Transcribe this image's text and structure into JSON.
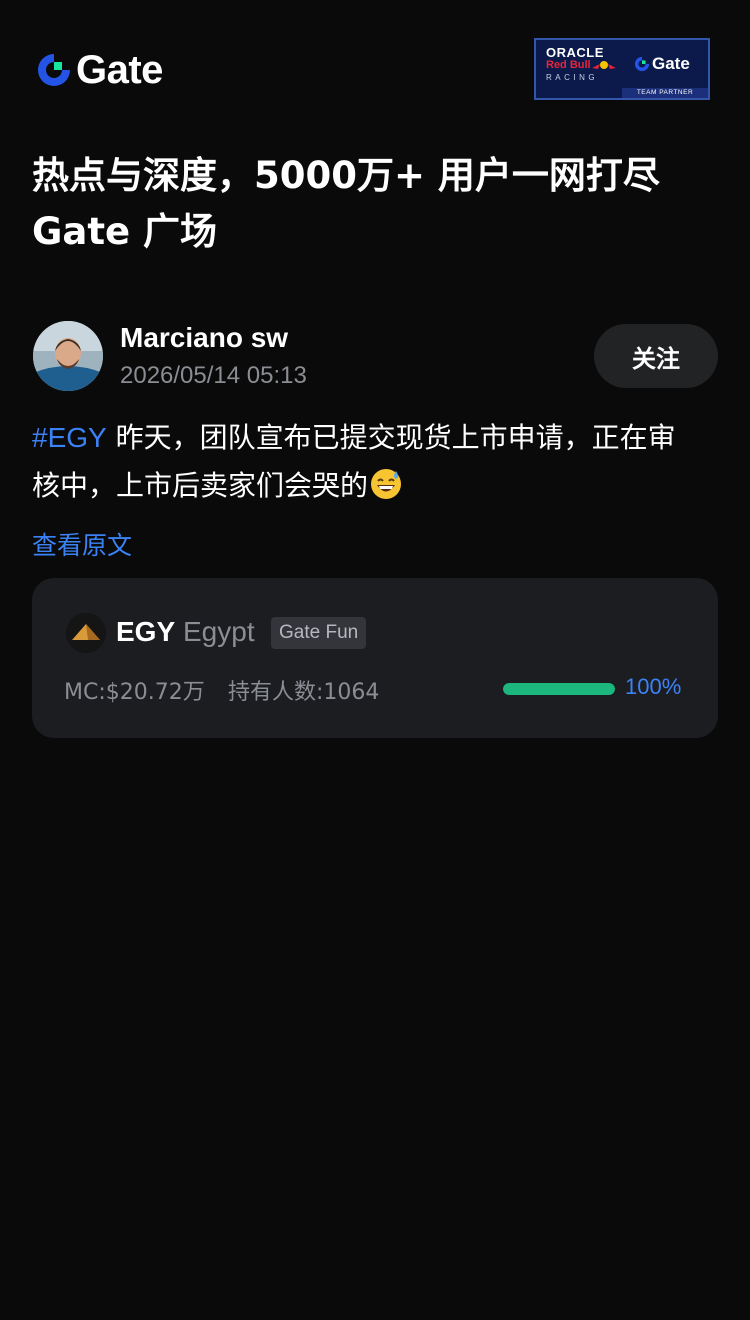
{
  "brand": {
    "name": "Gate",
    "accent_color": "#2354e6",
    "logo_green": "#17e6a1"
  },
  "partner_badge": {
    "line1": "ORACLE",
    "line2": "Red Bull",
    "line3": "RACING",
    "gate_text": "Gate",
    "strip_text": "TEAM PARTNER"
  },
  "headline": {
    "line1": "热点与深度，5000万+ 用户一网打尽",
    "line2": "Gate 广场"
  },
  "post": {
    "author": {
      "name": "Marciano sw",
      "avatar_icon": "user-photo-avatar"
    },
    "timestamp": "2026/05/14 05:13",
    "follow_label": "关注",
    "hashtag": "#EGY",
    "text_line1": " 昨天，团队宣布已提交现货上市申请，正在审",
    "text_line2": "核中，上市后卖家们会哭的",
    "emoji": "grinning-sweat-emoji",
    "view_original_label": "查看原文"
  },
  "token_card": {
    "symbol": "EGY",
    "name": "Egypt",
    "tag": "Gate Fun",
    "icon": "pyramid-icon",
    "market_cap": "MC:$20.72万",
    "holders": "持有人数:1064",
    "progress_percent": 100,
    "progress_label": "100%",
    "progress_color": "#1bb77f",
    "link_color": "#3b82f6"
  }
}
